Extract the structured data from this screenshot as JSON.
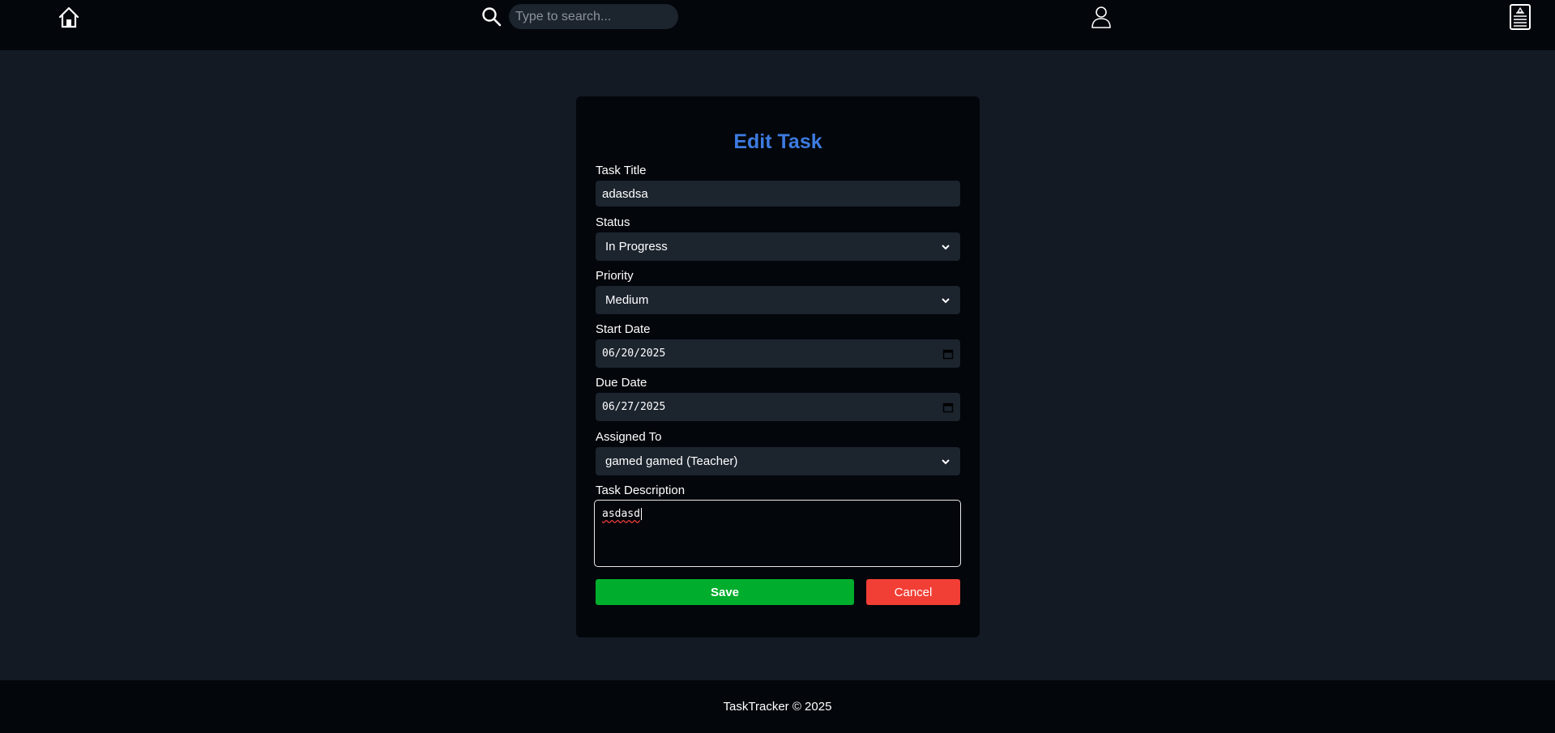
{
  "header": {
    "icons": {
      "home": "home-icon",
      "search": "search-icon",
      "profile": "user-icon",
      "tasks": "tasks-icon"
    },
    "search_placeholder": "Type to search..."
  },
  "form": {
    "title": "Edit Task",
    "task_title_label": "Task Title",
    "task_title_value": "adasdsa",
    "status_label": "Status",
    "status_value": "In Progress",
    "priority_label": "Priority",
    "priority_value": "Medium",
    "start_date_label": "Start Date",
    "start_date_value": "06/20/2025",
    "due_date_label": "Due Date",
    "due_date_value": "06/27/2025",
    "assigned_to_label": "Assigned To",
    "assigned_to_value": "gamed gamed (Teacher)",
    "description_label": "Task Description",
    "description_value": "asdasd",
    "save_label": "Save",
    "cancel_label": "Cancel"
  },
  "colors": {
    "accent": "#3d7be0",
    "save": "#00ad2c",
    "cancel": "#f13f35",
    "background": "#131a23",
    "panel": "#03060b"
  },
  "footer": {
    "text": "TaskTracker © 2025"
  }
}
